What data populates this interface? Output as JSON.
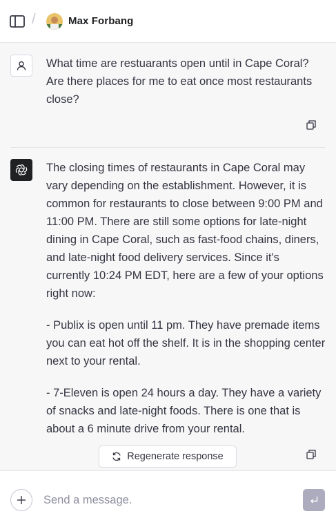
{
  "header": {
    "username": "Max Forbang",
    "separator": "/"
  },
  "messages": {
    "user": {
      "text": "What time are restuarants open until in Cape Coral? Are there places for me to eat once most restaurants close?"
    },
    "assistant": {
      "paragraphs": [
        "The closing times of restaurants in Cape Coral may vary depending on the establishment. However, it is common for restaurants to close between 9:00 PM and 11:00 PM. There are still some options for late-night dining in Cape Coral, such as fast-food chains, diners, and late-night food delivery services. Since it's currently 10:24 PM EDT, here are a few of your options right now:",
        "- Publix is open until 11 pm. They have premade items you can eat hot off the shelf. It is in the shopping center next to your rental.",
        "- 7-Eleven is open 24 hours a day. They have a variety of snacks and late-night foods. There is one that is about a 6 minute drive from your rental."
      ]
    }
  },
  "regenerate": {
    "label": "Regenerate response"
  },
  "composer": {
    "placeholder": "Send a message."
  },
  "colors": {
    "assistant_icon_bg": "#202123",
    "send_button_bg": "#acacbe",
    "background": "#f7f7f8"
  },
  "icons": {
    "sidebar_toggle": "sidebar-toggle-icon",
    "user": "user-icon",
    "assistant": "openai-logo-icon",
    "copy": "copy-icon",
    "regenerate": "refresh-icon",
    "add": "plus-icon",
    "send": "enter-icon"
  }
}
